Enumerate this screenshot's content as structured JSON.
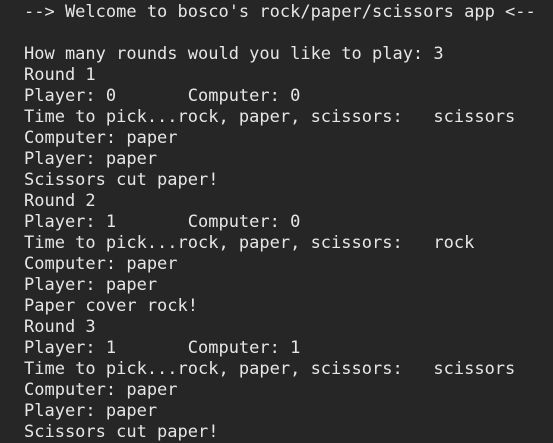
{
  "terminal": {
    "header": "--> Welcome to bosco's rock/paper/scissors app <--",
    "lines": [
      "",
      "How many rounds would you like to play: 3",
      "Round 1",
      "Player: 0       Computer: 0",
      "Time to pick...rock, paper, scissors:   scissors",
      "Computer: paper",
      "Player: paper",
      "Scissors cut paper!",
      "Round 2",
      "Player: 1       Computer: 0",
      "Time to pick...rock, paper, scissors:   rock",
      "Computer: paper",
      "Player: paper",
      "Paper cover rock!",
      "Round 3",
      "Player: 1       Computer: 1",
      "Time to pick...rock, paper, scissors:   scissors",
      "Computer: paper",
      "Player: paper",
      "Scissors cut paper!"
    ]
  },
  "colors": {
    "background": "#262626",
    "text": "#e6e6e6"
  }
}
